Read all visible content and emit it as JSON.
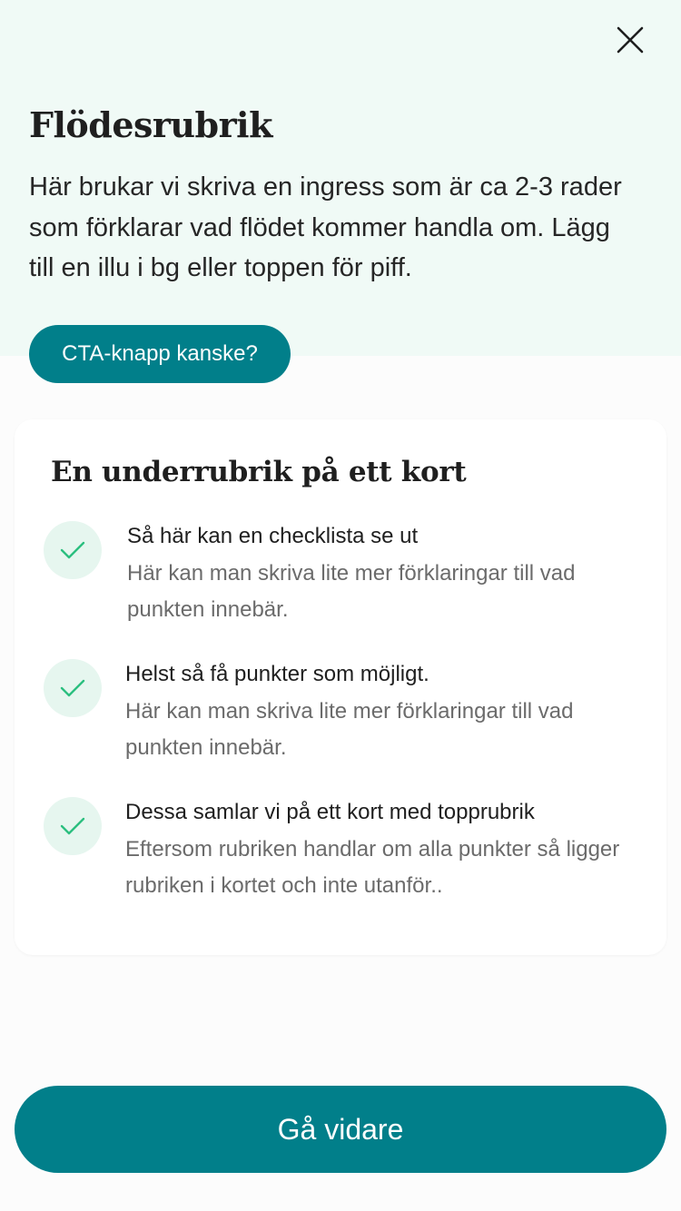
{
  "header": {
    "close_icon": "close-icon",
    "title": "Flödesrubrik",
    "lead": "Här brukar vi skriva en ingress som är ca 2-3 rader som förklarar vad flödet kommer handla om. Lägg till en illu i bg eller toppen för piff.",
    "cta_label": "CTA-knapp kanske?"
  },
  "card": {
    "title": "En underrubrik på ett kort",
    "items": [
      {
        "icon": "check-icon",
        "title": "Så här kan en checklista se ut",
        "description": "Här kan man skriva lite mer förklaringar till vad punkten innebär."
      },
      {
        "icon": "check-icon",
        "title": "Helst så få punkter som möjligt.",
        "description": "Här kan man skriva lite mer förklaringar till vad punkten innebär."
      },
      {
        "icon": "check-icon",
        "title": "Dessa samlar vi på ett kort med topprubrik",
        "description": "Eftersom rubriken handlar om alla punkter så ligger rubriken i kortet och inte utanför.."
      }
    ]
  },
  "footer": {
    "primary_label": "Gå vidare"
  },
  "colors": {
    "hero_bg": "#f0faf6",
    "primary": "#017f8a",
    "check_bg": "#e6f6ef",
    "check_mark": "#2bbf7f",
    "page_bg": "#fcfcfc"
  }
}
